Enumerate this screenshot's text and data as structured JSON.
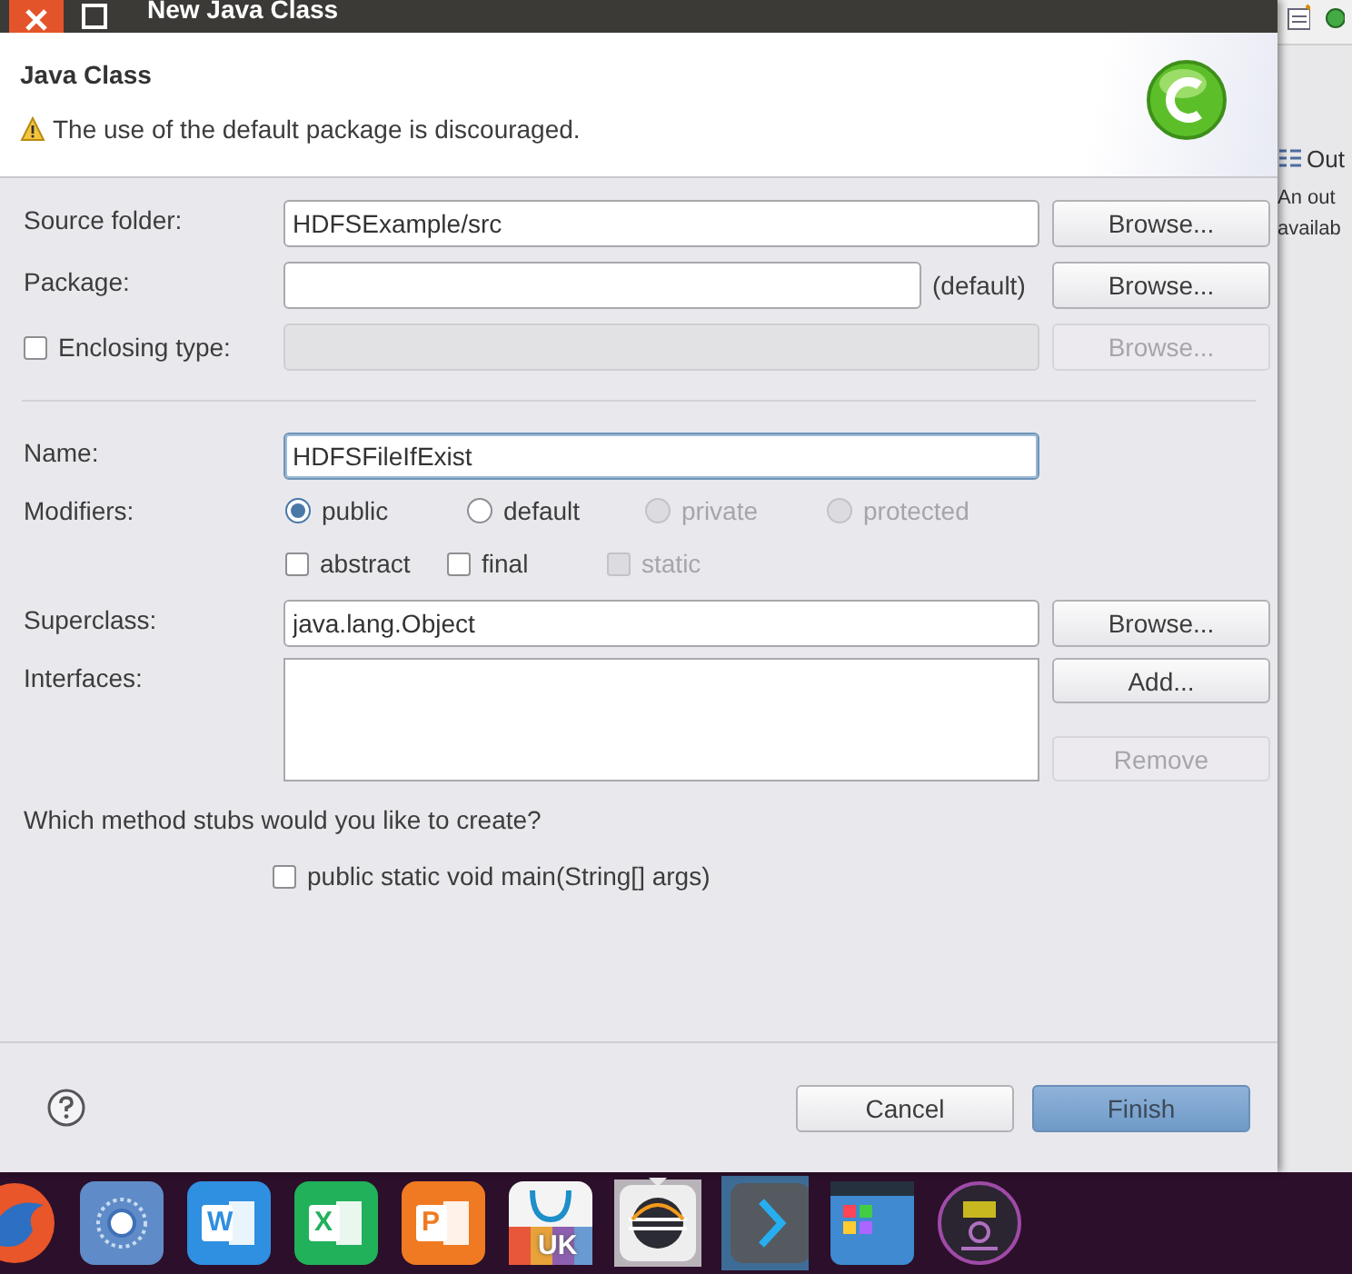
{
  "window": {
    "title": "New Java Class"
  },
  "header": {
    "title": "Java Class",
    "message": "The use of the default package is discouraged."
  },
  "fields_top": [
    {
      "kind": "text",
      "label": "Source folder:",
      "value": "HDFSExample/src",
      "button": {
        "label": "Browse...",
        "disabled": false
      }
    },
    {
      "kind": "text",
      "label": "Package:",
      "suffix": "(default)",
      "button": {
        "label": "Browse...",
        "disabled": false
      }
    },
    {
      "kind": "checkbox",
      "label": "Enclosing type:",
      "checked": false,
      "disabled": true,
      "button": {
        "label": "Browse...",
        "disabled": true
      }
    }
  ],
  "name": {
    "label": "Name:",
    "value": "HDFSFileIfExist",
    "focused": true
  },
  "modifiers": {
    "label": "Modifiers:",
    "radios": [
      {
        "label": "public",
        "selected": true,
        "disabled": false
      },
      {
        "label": "default",
        "selected": false,
        "disabled": false
      },
      {
        "label": "private",
        "selected": false,
        "disabled": true
      },
      {
        "label": "protected",
        "selected": false,
        "disabled": true
      }
    ],
    "checkboxes": [
      {
        "label": "abstract",
        "checked": false,
        "disabled": false
      },
      {
        "label": "final",
        "checked": false,
        "disabled": false
      },
      {
        "label": "static",
        "checked": false,
        "disabled": true
      }
    ]
  },
  "superclass": {
    "label": "Superclass:",
    "value": "java.lang.Object",
    "button": {
      "label": "Browse...",
      "disabled": false
    }
  },
  "interfaces": {
    "label": "Interfaces:",
    "buttons": [
      {
        "label": "Add...",
        "disabled": false
      },
      {
        "label": "Remove",
        "disabled": true
      }
    ]
  },
  "stubs": {
    "question": "Which method stubs would you like to create?",
    "options": [
      {
        "label": "public static void main(String[] args)",
        "checked": false
      }
    ]
  },
  "footer": {
    "buttons": [
      {
        "label": "Cancel",
        "default": false
      },
      {
        "label": "Finish",
        "default": true
      }
    ]
  },
  "side_panel": {
    "tab": "Out",
    "lines": [
      "An out",
      "availab"
    ]
  },
  "taskbar": [
    {
      "kind": "firefox",
      "selected": false
    },
    {
      "kind": "browser",
      "selected": false
    },
    {
      "kind": "word",
      "glyph": "W",
      "selected": false
    },
    {
      "kind": "excel",
      "glyph": "X",
      "selected": false
    },
    {
      "kind": "powerpoint",
      "glyph": "P",
      "selected": false
    },
    {
      "kind": "store",
      "glyph": "UK",
      "selected": false
    },
    {
      "kind": "eclipse",
      "selected": true
    },
    {
      "kind": "terminal",
      "selected": false
    },
    {
      "kind": "windows",
      "selected": false
    },
    {
      "kind": "disc",
      "selected": false
    }
  ]
}
